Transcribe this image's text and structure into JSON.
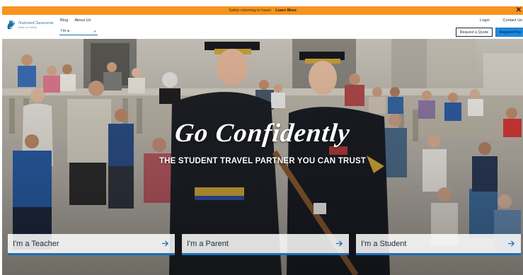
{
  "announcement": {
    "message": "Safely returning to travel.",
    "link": "Learn More"
  },
  "header": {
    "logo": {
      "brand": "NationsClassroom",
      "tagline": "Made on Liberty"
    },
    "nav_links": [
      "Blog",
      "About Us"
    ],
    "role_select": {
      "value": "I'm a"
    },
    "right_links": [
      "Login",
      "Contact Us"
    ],
    "quote_button": "Request a Quote",
    "register_button": "Register/Pay"
  },
  "hero": {
    "headline": "Go Confidently",
    "subheadline": "THE STUDENT TRAVEL PARTNER YOU CAN TRUST",
    "role_buttons": [
      {
        "label": "I'm a Teacher"
      },
      {
        "label": "I'm a Parent"
      },
      {
        "label": "I'm a Student"
      }
    ]
  },
  "colors": {
    "announcement_bg": "#f7941d",
    "accent_blue": "#1c6fb8",
    "register_bg": "#1f8ae0"
  },
  "icons": {
    "close": "close-icon",
    "caret": "chevron-down-icon",
    "arrow": "arrow-right-icon",
    "logo": "hand-logo-icon"
  }
}
